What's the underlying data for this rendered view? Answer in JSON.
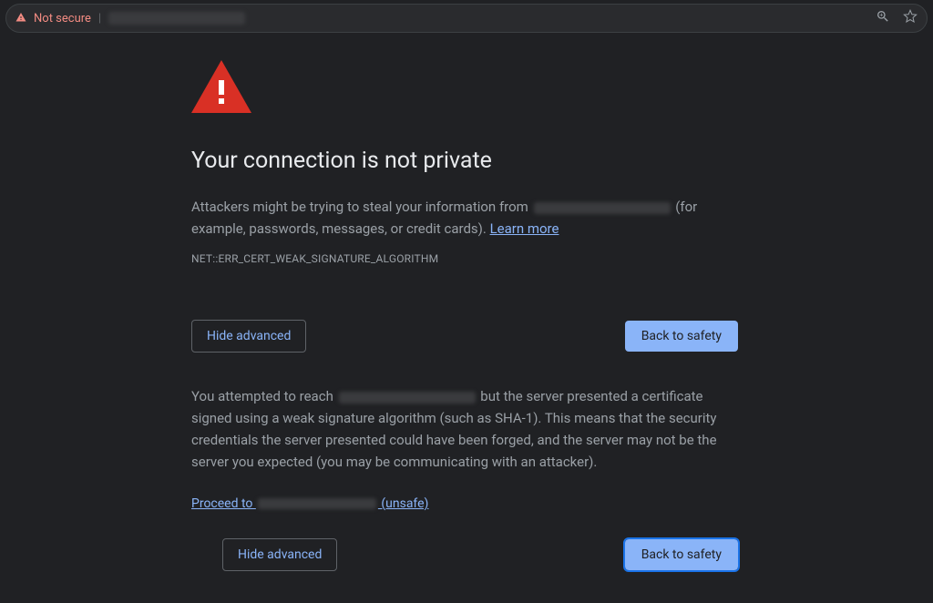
{
  "address_bar": {
    "not_secure_label": "Not secure"
  },
  "warning": {
    "title": "Your connection is not private",
    "body_prefix": "Attackers might be trying to steal your information from ",
    "body_suffix": " (for example, passwords, messages, or credit cards). ",
    "learn_more": "Learn more",
    "error_code": "NET::ERR_CERT_WEAK_SIGNATURE_ALGORITHM"
  },
  "buttons": {
    "hide_advanced": "Hide advanced",
    "back_to_safety": "Back to safety"
  },
  "details": {
    "text_prefix": "You attempted to reach ",
    "text_suffix": " but the server presented a certificate signed using a weak signature algorithm (such as SHA-1). This means that the security credentials the server presented could have been forged, and the server may not be the server you expected (you may be communicating with an attacker).",
    "proceed_prefix": "Proceed to ",
    "proceed_suffix": " (unsafe)"
  }
}
